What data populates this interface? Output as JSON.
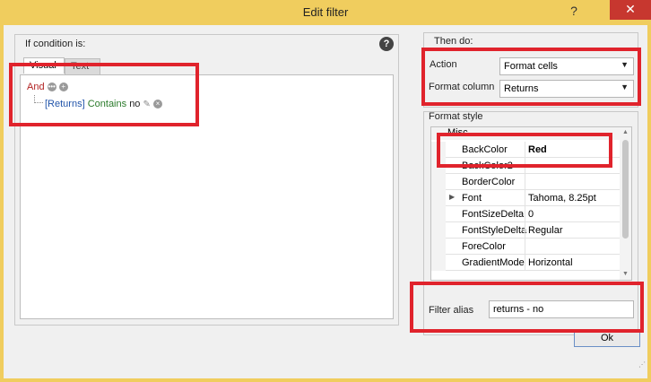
{
  "window": {
    "title": "Edit filter",
    "help_glyph": "?",
    "close_glyph": "✕"
  },
  "left": {
    "group_label": "If condition is:",
    "help_badge": "?",
    "tabs": [
      {
        "label": "Visual"
      },
      {
        "label": "Text"
      }
    ],
    "tree": {
      "group_op": "And",
      "condition": {
        "field": "[Returns]",
        "operator": "Contains",
        "value": "no"
      }
    }
  },
  "right": {
    "group_label": "Then do:",
    "action": {
      "label": "Action",
      "value": "Format cells"
    },
    "format_column": {
      "label": "Format column",
      "value": "Returns"
    },
    "format_style": {
      "label": "Format style",
      "category": "Misc",
      "properties": [
        {
          "name": "BackColor",
          "value": "Red",
          "bold": true
        },
        {
          "name": "BackColor2",
          "value": ""
        },
        {
          "name": "BorderColor",
          "value": ""
        },
        {
          "name": "Font",
          "value": "Tahoma, 8.25pt",
          "expandable": true
        },
        {
          "name": "FontSizeDelta",
          "value": "0"
        },
        {
          "name": "FontStyleDelta",
          "value": "Regular"
        },
        {
          "name": "ForeColor",
          "value": ""
        },
        {
          "name": "GradientMode",
          "value": "Horizontal"
        }
      ]
    },
    "filter_alias": {
      "label": "Filter alias",
      "value": "returns - no"
    }
  },
  "buttons": {
    "ok": "Ok"
  },
  "colors": {
    "highlight": "#e0232c",
    "titlebar": "#f0cd5e",
    "close": "#c7372f"
  }
}
